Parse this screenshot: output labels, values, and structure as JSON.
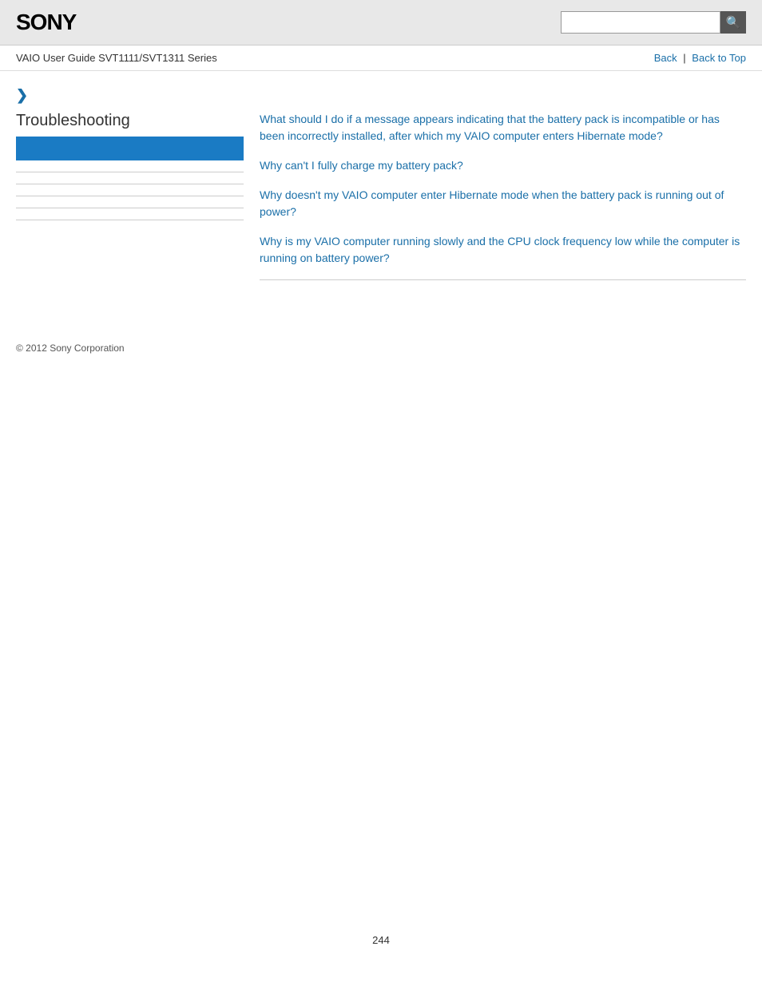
{
  "header": {
    "logo": "SONY",
    "search_placeholder": "",
    "search_icon": "🔍"
  },
  "nav": {
    "guide_title": "VAIO User Guide SVT1111/SVT1311 Series",
    "back_label": "Back",
    "separator": "|",
    "back_to_top_label": "Back to Top"
  },
  "sidebar": {
    "chevron": "❯",
    "section_title": "Troubleshooting",
    "items": [
      {
        "label": ""
      },
      {
        "label": ""
      },
      {
        "label": ""
      },
      {
        "label": ""
      },
      {
        "label": ""
      }
    ]
  },
  "content": {
    "links": [
      {
        "text": "What should I do if a message appears indicating that the battery pack is incompatible or has been incorrectly installed, after which my VAIO computer enters Hibernate mode?"
      },
      {
        "text": "Why can't I fully charge my battery pack?"
      },
      {
        "text": "Why doesn't my VAIO computer enter Hibernate mode when the battery pack is running out of power?"
      },
      {
        "text": "Why is my VAIO computer running slowly and the CPU clock frequency low while the computer is running on battery power?"
      }
    ]
  },
  "footer": {
    "copyright": "© 2012 Sony Corporation"
  },
  "page_number": "244",
  "colors": {
    "link_blue": "#1a6fa8",
    "active_bar": "#1a7bc4",
    "header_bg": "#e8e8e8"
  }
}
